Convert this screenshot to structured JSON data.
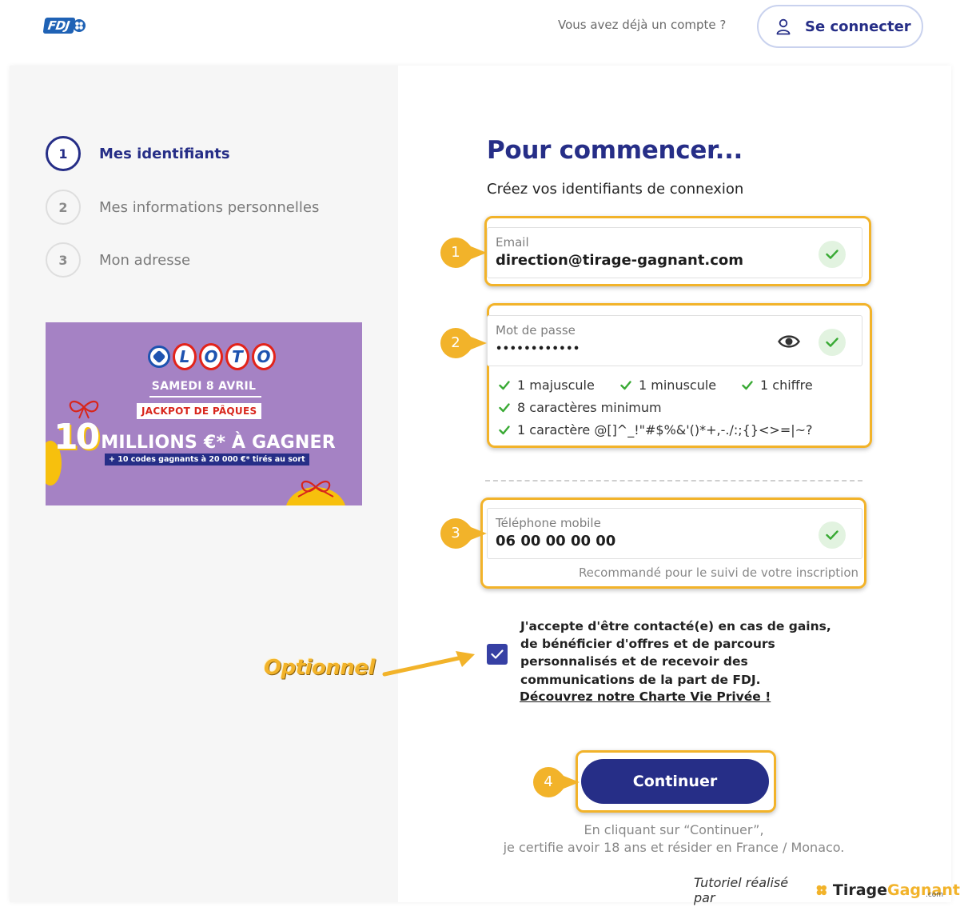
{
  "header": {
    "logo_text": "FDJ",
    "question": "Vous avez déjà un compte ?",
    "login_label": "Se connecter"
  },
  "steps": [
    {
      "number": "1",
      "label": "Mes identifiants",
      "state": "active"
    },
    {
      "number": "2",
      "label": "Mes informations personnelles",
      "state": "inactive"
    },
    {
      "number": "3",
      "label": "Mon adresse",
      "state": "inactive"
    }
  ],
  "promo": {
    "brand": "LOTO",
    "brand_letters": [
      "L",
      "O",
      "T",
      "O"
    ],
    "date": "SAMEDI 8 AVRIL",
    "jackpot": "JACKPOT DE PÂQUES",
    "amount_number": "10",
    "amount_text": "MILLIONS €* À GAGNER",
    "sub": "+ 10 codes gagnants à 20 000 €* tirés au sort"
  },
  "form": {
    "title": "Pour commencer...",
    "subtitle": "Créez vos identifiants de connexion",
    "email": {
      "label": "Email",
      "value": "direction@tirage-gagnant.com"
    },
    "password": {
      "label": "Mot de passe",
      "value": "••••••••••••"
    },
    "password_rules": [
      "1 majuscule",
      "1 minuscule",
      "1 chiffre",
      "8 caractères minimum",
      "1 caractère @[]^_!\"#$%&'()*+,-./:;{}<>=|~?"
    ],
    "phone": {
      "label": "Téléphone mobile",
      "value": "06 00 00 00 00",
      "hint": "Recommandé pour le suivi de votre inscription"
    },
    "consent": {
      "checked": true,
      "text": "J'accepte d'être contacté(e) en cas de gains, de bénéficier d'offres et de parcours personnalisés et de recevoir des communications de la part de FDJ.",
      "link": "Découvrez notre Charte Vie Privée !"
    },
    "continue_label": "Continuer",
    "legal_line1": "En cliquant sur “Continuer”,",
    "legal_line2": "je certifie avoir 18 ans et résider en France / Monaco."
  },
  "annotations": {
    "badges": [
      "1",
      "2",
      "3",
      "4"
    ],
    "optional": "Optionnel",
    "color": "#f2b32a"
  },
  "credit": {
    "prefix": "Tutoriel réalisé par",
    "brand_part1": "Tirage",
    "brand_part2": "Gagnant",
    "domain": ".com"
  },
  "colors": {
    "primary": "#262e87",
    "check_green": "#3aaa35",
    "highlight": "#f2b32a",
    "promo_bg": "#a582c4"
  }
}
